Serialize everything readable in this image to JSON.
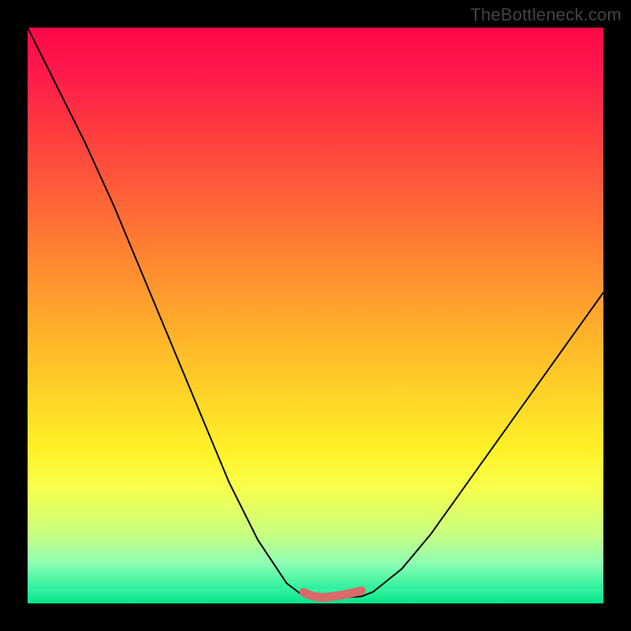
{
  "watermark": {
    "text": "TheBottleneck.com"
  },
  "chart_data": {
    "type": "line",
    "title": "",
    "xlabel": "",
    "ylabel": "",
    "xlim": [
      0,
      100
    ],
    "ylim": [
      0,
      100
    ],
    "grid": false,
    "legend": false,
    "series": [
      {
        "name": "bottleneck-curve",
        "x": [
          0,
          5,
          10,
          15,
          20,
          25,
          30,
          35,
          40,
          45,
          48,
          50,
          52,
          55,
          58,
          60,
          65,
          70,
          75,
          80,
          85,
          90,
          95,
          100
        ],
        "values": [
          100,
          90,
          80,
          69,
          57,
          45,
          33,
          21,
          11,
          3.5,
          1.2,
          1,
          1,
          1,
          1.2,
          2,
          6,
          12,
          19,
          26,
          33,
          40,
          47,
          54
        ]
      },
      {
        "name": "flat-highlight",
        "x": [
          48,
          58
        ],
        "values": [
          1.6,
          1.6
        ]
      }
    ],
    "colors": {
      "curve": "#000000",
      "flat_highlight": "#d86a6a",
      "gradient_top": "#ff0748",
      "gradient_bottom": "#00e58a"
    }
  }
}
